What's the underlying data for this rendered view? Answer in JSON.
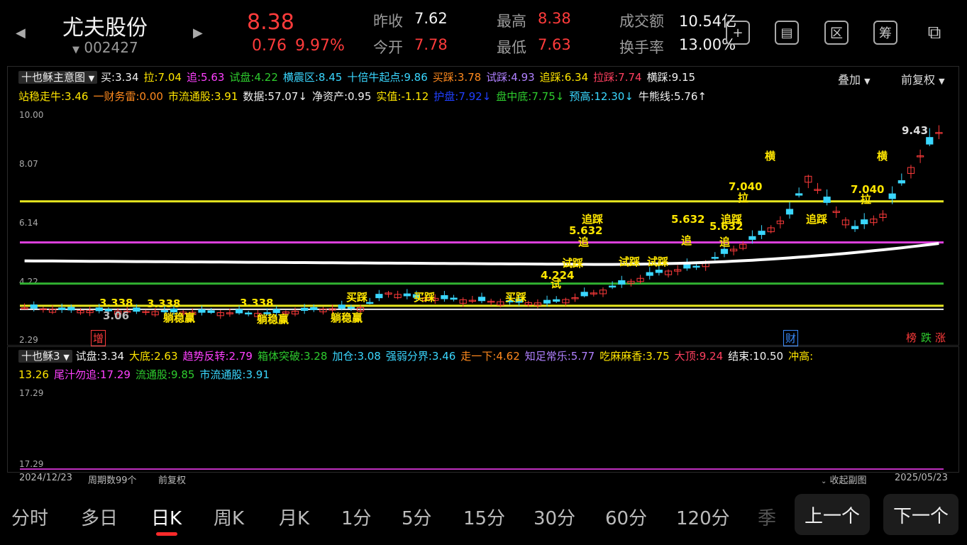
{
  "header": {
    "name": "尤夫股份",
    "code": "002427",
    "price": "8.38",
    "change": "0.76",
    "change_pct": "9.97%",
    "stats": [
      {
        "label": "昨收",
        "value": "7.62"
      },
      {
        "label": "今开",
        "value": "7.78"
      },
      {
        "label": "最高",
        "value": "8.38"
      },
      {
        "label": "最低",
        "value": "7.63"
      },
      {
        "label": "成交额",
        "value": "10.54亿"
      },
      {
        "label": "换手率",
        "value": "13.00%"
      }
    ],
    "tools": [
      "+",
      "▤",
      "区",
      "筹",
      "⧉"
    ]
  },
  "main_panel": {
    "selector": "十也稣主意图",
    "overlay": "叠加",
    "adjust": "前复权",
    "row1": [
      {
        "t": "买:3.34",
        "c": "#f0f0f0"
      },
      {
        "t": "拉:7.04",
        "c": "#ffe600"
      },
      {
        "t": "追:5.63",
        "c": "#ff40ff"
      },
      {
        "t": "试盘:4.22",
        "c": "#2ecc2e"
      },
      {
        "t": "横震区:8.45",
        "c": "#3ad7ff"
      },
      {
        "t": "十倍牛起点:9.86",
        "c": "#3ad7ff"
      },
      {
        "t": "买踩:3.78",
        "c": "#ff8a1e"
      },
      {
        "t": "试踩:4.93",
        "c": "#b080ff"
      },
      {
        "t": "追踩:6.34",
        "c": "#ffe600"
      },
      {
        "t": "拉踩:7.74",
        "c": "#ff4060"
      },
      {
        "t": "横踩:9.15",
        "c": "#f0f0f0"
      }
    ],
    "row2": [
      {
        "t": "站稳走牛:3.46",
        "c": "#ffe600"
      },
      {
        "t": "一财务雷:0.00",
        "c": "#ff8a1e"
      },
      {
        "t": "市流通股:3.91",
        "c": "#ffe600"
      },
      {
        "t": "数据:57.07↓",
        "c": "#f0f0f0"
      },
      {
        "t": "净资产:0.95",
        "c": "#f0f0f0"
      },
      {
        "t": "实值:-1.12",
        "c": "#ffe600"
      },
      {
        "t": "护盘:7.92↓",
        "c": "#2040ff"
      },
      {
        "t": "盘中底:7.75↓",
        "c": "#2ecc2e"
      },
      {
        "t": "预高:12.30↓",
        "c": "#3ad7ff"
      },
      {
        "t": "牛熊线:5.76↑",
        "c": "#f0f0f0"
      }
    ],
    "y_ticks": [
      "10.00",
      "8.07",
      "6.14",
      "4.22",
      "2.29"
    ],
    "badges_left": "增",
    "badges_mid": "财",
    "badges_right": [
      "榜",
      "跌",
      "涨"
    ]
  },
  "chart_data": {
    "type": "candlestick",
    "ylim": [
      2.29,
      10.0
    ],
    "y_ticks": [
      10.0,
      8.07,
      6.14,
      4.22,
      2.29
    ],
    "date_start": "2024/12/23",
    "date_end": "2025/05/23",
    "period_count": 99,
    "hlines": [
      {
        "value": 7.04,
        "color": "#e8e820"
      },
      {
        "value": 5.63,
        "color": "#e040e0"
      },
      {
        "value": 4.22,
        "color": "#30b030"
      },
      {
        "value": 3.46,
        "color": "#e8e820"
      },
      {
        "value": 3.34,
        "color": "#f0f0f0"
      }
    ],
    "annotations": [
      {
        "text": "3.338",
        "color": "#ffe600"
      },
      {
        "text": "3.338",
        "color": "#ffe600"
      },
      {
        "text": "3.338",
        "color": "#ffe600"
      },
      {
        "text": "3.06",
        "color": "#bbbbbb"
      },
      {
        "text": "躺稳赢",
        "color": "#ffe600"
      },
      {
        "text": "躺稳赢",
        "color": "#ffe600"
      },
      {
        "text": "躺稳赢",
        "color": "#ffe600"
      },
      {
        "text": "买踩",
        "color": "#ffe600"
      },
      {
        "text": "买踩",
        "color": "#ffe600"
      },
      {
        "text": "买踩",
        "color": "#ffe600"
      },
      {
        "text": "4.224",
        "color": "#ffe600"
      },
      {
        "text": "试",
        "color": "#ffe600"
      },
      {
        "text": "试踩",
        "color": "#ffe600"
      },
      {
        "text": "试踩",
        "color": "#ffe600"
      },
      {
        "text": "试踩",
        "color": "#ffe600"
      },
      {
        "text": "5.632",
        "color": "#ffe600"
      },
      {
        "text": "5.632",
        "color": "#ffe600"
      },
      {
        "text": "5.632",
        "color": "#ffe600"
      },
      {
        "text": "追",
        "color": "#ffe600"
      },
      {
        "text": "追",
        "color": "#ffe600"
      },
      {
        "text": "追",
        "color": "#ffe600"
      },
      {
        "text": "追踩",
        "color": "#ffe600"
      },
      {
        "text": "追踩",
        "color": "#ffe600"
      },
      {
        "text": "追踩",
        "color": "#ffe600"
      },
      {
        "text": "7.040",
        "color": "#ffe600"
      },
      {
        "text": "7.040",
        "color": "#ffe600"
      },
      {
        "text": "拉",
        "color": "#ffe600"
      },
      {
        "text": "拉",
        "color": "#ffe600"
      },
      {
        "text": "横",
        "color": "#ffe600"
      },
      {
        "text": "横",
        "color": "#ffe600"
      },
      {
        "text": "9.43",
        "color": "#dddddd"
      }
    ]
  },
  "sub_panel": {
    "selector": "十也稣3",
    "row1": [
      {
        "t": "试盘:3.34",
        "c": "#f0f0f0"
      },
      {
        "t": "大底:2.63",
        "c": "#ffe600"
      },
      {
        "t": "趋势反转:2.79",
        "c": "#ff40ff"
      },
      {
        "t": "箱体突破:3.28",
        "c": "#2ecc2e"
      },
      {
        "t": "加仓:3.08",
        "c": "#3ad7ff"
      },
      {
        "t": "强弱分界:3.46",
        "c": "#3ad7ff"
      },
      {
        "t": "走一下:4.62",
        "c": "#ff8a1e"
      },
      {
        "t": "知足常乐:5.77",
        "c": "#b080ff"
      },
      {
        "t": "吃麻麻香:3.75",
        "c": "#ffe600"
      },
      {
        "t": "大顶:9.24",
        "c": "#ff4060"
      },
      {
        "t": "结束:10.50",
        "c": "#f0f0f0"
      },
      {
        "t": "冲高:",
        "c": "#ffe600"
      }
    ],
    "row2": [
      {
        "t": "13.26",
        "c": "#ffe600"
      },
      {
        "t": "尾汁勿追:17.29",
        "c": "#ff40ff"
      },
      {
        "t": "流通股:9.85",
        "c": "#2ecc2e"
      },
      {
        "t": "市流通股:3.91",
        "c": "#3ad7ff"
      }
    ],
    "y_top": "17.29",
    "y_bottom": "17.29"
  },
  "bottom_bar": {
    "start_date": "2024/12/23",
    "period_count": "周期数99个",
    "adjust": "前复权",
    "collapse": "收起副图",
    "end_date": "2025/05/23"
  },
  "periods": {
    "tabs": [
      "分时",
      "多日",
      "日K",
      "周K",
      "月K",
      "1分",
      "5分",
      "15分",
      "30分",
      "60分",
      "120分",
      "季"
    ],
    "active": "日K",
    "prev": "上一个",
    "next": "下一个"
  }
}
